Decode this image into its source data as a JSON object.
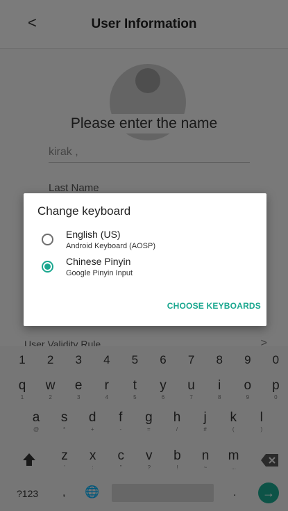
{
  "app": {
    "back_glyph": "<",
    "title": "User Information",
    "prompt": "Please enter the name",
    "name_value": "kirak ,",
    "last_name_label": "Last Name",
    "validity_label": "User Validity Rule",
    "validity_arrow": ">"
  },
  "dialog": {
    "title": "Change keyboard",
    "options": [
      {
        "name": "English (US)",
        "sub": "Android Keyboard (AOSP)",
        "selected": false
      },
      {
        "name": "Chinese Pinyin",
        "sub": "Google Pinyin Input",
        "selected": true
      }
    ],
    "action": "CHOOSE KEYBOARDS"
  },
  "keyboard": {
    "numbers": [
      "1",
      "2",
      "3",
      "4",
      "5",
      "6",
      "7",
      "8",
      "9",
      "0"
    ],
    "row1": [
      {
        "k": "q",
        "s": "1"
      },
      {
        "k": "w",
        "s": "2"
      },
      {
        "k": "e",
        "s": "3"
      },
      {
        "k": "r",
        "s": "4"
      },
      {
        "k": "t",
        "s": "5"
      },
      {
        "k": "y",
        "s": "6"
      },
      {
        "k": "u",
        "s": "7"
      },
      {
        "k": "i",
        "s": "8"
      },
      {
        "k": "o",
        "s": "9"
      },
      {
        "k": "p",
        "s": "0"
      }
    ],
    "row2": [
      {
        "k": "a",
        "s": "@"
      },
      {
        "k": "s",
        "s": "*"
      },
      {
        "k": "d",
        "s": "+"
      },
      {
        "k": "f",
        "s": "-"
      },
      {
        "k": "g",
        "s": "="
      },
      {
        "k": "h",
        "s": "/"
      },
      {
        "k": "j",
        "s": "#"
      },
      {
        "k": "k",
        "s": "("
      },
      {
        "k": "l",
        "s": ")"
      }
    ],
    "row3": [
      {
        "k": "z",
        "s": "'"
      },
      {
        "k": "x",
        "s": ":"
      },
      {
        "k": "c",
        "s": "\""
      },
      {
        "k": "v",
        "s": "?"
      },
      {
        "k": "b",
        "s": "!"
      },
      {
        "k": "n",
        "s": "~"
      },
      {
        "k": "m",
        "s": "..."
      }
    ],
    "symbols_key": "?123",
    "comma_key": ",",
    "period_key": ".",
    "globe_glyph": "🌐",
    "enter_glyph": "→",
    "accent_color": "#1aa78f"
  }
}
